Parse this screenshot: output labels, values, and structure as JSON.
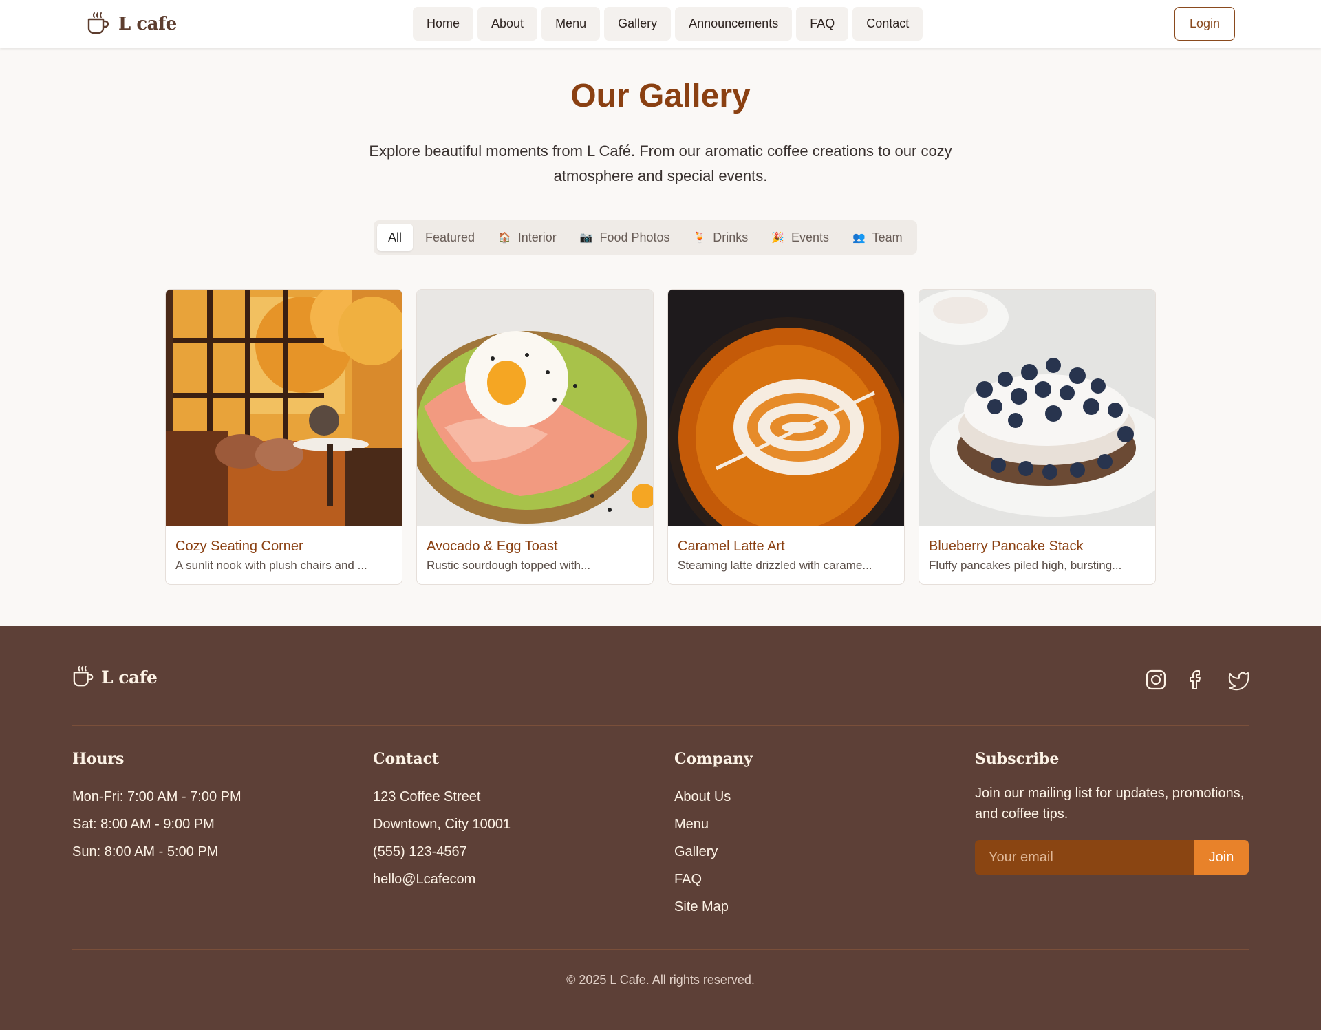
{
  "header": {
    "brand": "L cafe",
    "nav": [
      "Home",
      "About",
      "Menu",
      "Gallery",
      "Announcements",
      "FAQ",
      "Contact"
    ],
    "login_label": "Login"
  },
  "hero": {
    "title": "Our Gallery",
    "intro": "Explore beautiful moments from L Café. From our aromatic coffee creations to our cozy atmosphere and special events."
  },
  "filters": [
    {
      "label": "All",
      "icon": "",
      "active": true
    },
    {
      "label": "Featured",
      "icon": "",
      "active": false
    },
    {
      "label": "Interior",
      "icon": "house-icon",
      "active": false
    },
    {
      "label": "Food Photos",
      "icon": "camera-icon",
      "active": false
    },
    {
      "label": "Drinks",
      "icon": "drink-icon",
      "active": false
    },
    {
      "label": "Events",
      "icon": "party-popper-icon",
      "active": false
    },
    {
      "label": "Team",
      "icon": "people-icon",
      "active": false
    }
  ],
  "gallery": [
    {
      "title": "Cozy Seating Corner",
      "desc": "A sunlit nook with plush chairs and ..."
    },
    {
      "title": "Avocado & Egg Toast",
      "desc": "Rustic sourdough topped with..."
    },
    {
      "title": "Caramel Latte Art",
      "desc": "Steaming latte drizzled with carame..."
    },
    {
      "title": "Blueberry Pancake Stack",
      "desc": "Fluffy pancakes piled high, bursting..."
    }
  ],
  "footer": {
    "brand": "L cafe",
    "social": [
      "instagram-icon",
      "facebook-icon",
      "twitter-icon"
    ],
    "hours": {
      "heading": "Hours",
      "lines": [
        "Mon-Fri: 7:00 AM - 7:00 PM",
        "Sat: 8:00 AM - 9:00 PM",
        "Sun: 8:00 AM - 5:00 PM"
      ]
    },
    "contact": {
      "heading": "Contact",
      "lines": [
        "123 Coffee Street",
        "Downtown, City 10001",
        "(555) 123-4567",
        "hello@Lcafecom"
      ]
    },
    "company": {
      "heading": "Company",
      "links": [
        "About Us",
        "Menu",
        "Gallery",
        "FAQ",
        "Site Map"
      ]
    },
    "subscribe": {
      "heading": "Subscribe",
      "text": "Join our mailing list for updates, promotions, and coffee tips.",
      "placeholder": "Your email",
      "button": "Join"
    },
    "copyright": "© 2025 L Cafe. All rights reserved."
  },
  "colors": {
    "accent": "#8a4012",
    "footer_bg": "#5d4037",
    "join_button": "#e8822a"
  }
}
